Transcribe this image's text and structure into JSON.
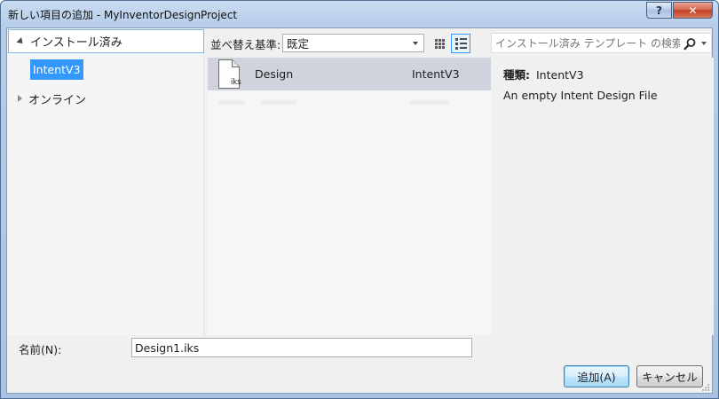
{
  "window": {
    "title": "新しい項目の追加 - MyInventorDesignProject",
    "help_label": "?",
    "close_label": "✕"
  },
  "tree": {
    "installed_label": "インストール済み",
    "child_label": "IntentV3",
    "online_label": "オンライン"
  },
  "toolbar": {
    "sort_label": "並べ替え基準:",
    "sort_value": "既定"
  },
  "search": {
    "placeholder": "インストール済み テンプレート の検索"
  },
  "templates": [
    {
      "name": "Design",
      "type": "IntentV3",
      "ext": "iks",
      "selected": true
    }
  ],
  "details": {
    "type_key": "種類:",
    "type_value": "IntentV3",
    "description": "An empty Intent Design File"
  },
  "footer": {
    "name_label": "名前(N):",
    "name_value": "Design1.iks",
    "add_label": "追加(A)",
    "cancel_label": "キャンセル"
  },
  "colors": {
    "selection": "#3399ff",
    "row_selected": "#cfd3de",
    "close": "#c23b1f"
  }
}
